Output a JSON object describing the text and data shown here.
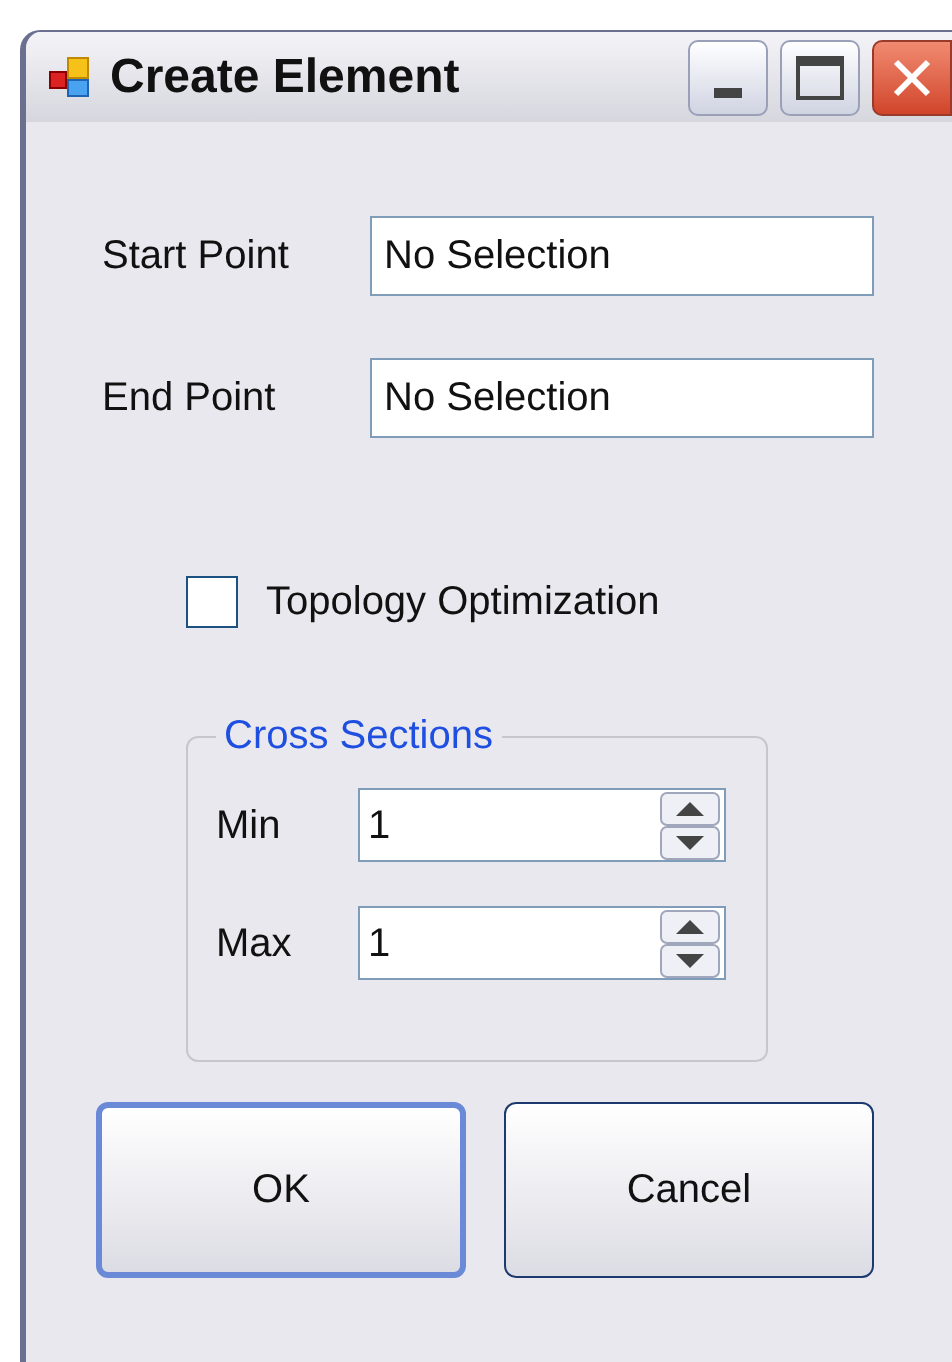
{
  "window": {
    "title": "Create Element"
  },
  "fields": [
    {
      "label": "Start Point",
      "value": "No Selection"
    },
    {
      "label": "End Point",
      "value": "No Selection"
    }
  ],
  "checkbox": {
    "label": "Topology Optimization",
    "checked": false
  },
  "cross_sections": {
    "title": "Cross Sections",
    "spinners": [
      {
        "label": "Min",
        "value": "1"
      },
      {
        "label": "Max",
        "value": "1"
      }
    ]
  },
  "buttons": [
    {
      "label": "OK",
      "selected": true
    },
    {
      "label": "Cancel",
      "selected": false
    }
  ]
}
